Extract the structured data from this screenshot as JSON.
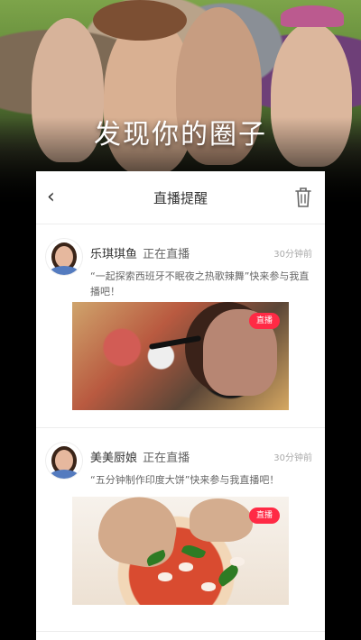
{
  "hero": {
    "title": "发现你的圈子"
  },
  "header": {
    "back_icon": "chevron-left-icon",
    "title": "直播提醒",
    "delete_icon": "trash-icon"
  },
  "posts": [
    {
      "name": "乐琪琪鱼",
      "status": "正在直播",
      "time": "30分钟前",
      "message": "“一起探索西班牙不眠夜之热歌辣舞”快来参与我直播吧！",
      "badge": "直播"
    },
    {
      "name": "美美厨娘",
      "status": "正在直播",
      "time": "30分钟前",
      "message": "“五分钟制作印度大饼”快来参与我直播吧！",
      "badge": "直播"
    }
  ]
}
